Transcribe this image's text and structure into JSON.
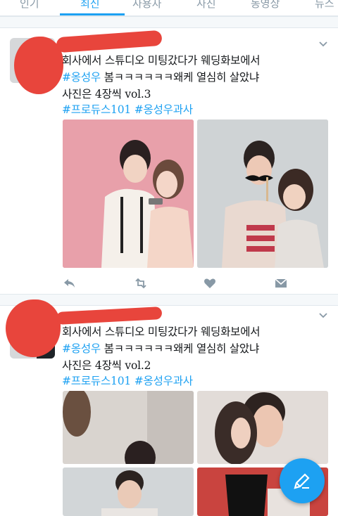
{
  "tabs": [
    "인기",
    "최신",
    "사용자",
    "사진",
    "동영상",
    "뉴스"
  ],
  "active_tab": "최신",
  "tweets": [
    {
      "line1": "회사에서 스튜디오 미팅갔다가 웨딩화보에서",
      "hashtag_inline": "#옹성우",
      "line2_rest": " 봄ㅋㅋㅋㅋㅋㅋ왜케 열심히 살았냐",
      "line3": "사진은 4장씩 vol.3",
      "tag1": "#프로듀스101",
      "tag2": "#옹성우과사"
    },
    {
      "line1": "회사에서 스튜디오 미팅갔다가 웨딩화보에서",
      "hashtag_inline": "#옹성우",
      "line2_rest": " 봄ㅋㅋㅋㅋㅋㅋ왜케 열심히 살았냐",
      "line3": "사진은 4장씩 vol.2",
      "tag1": "#프로듀스101",
      "tag2": "#옹성우과사"
    }
  ],
  "colors": {
    "accent": "#1da1f2",
    "redaction": "#e8453c",
    "icon_gray": "#8899a6"
  },
  "icons": [
    "reply-icon",
    "retweet-icon",
    "like-icon",
    "dm-icon",
    "compose-icon",
    "chevron-down-icon"
  ]
}
